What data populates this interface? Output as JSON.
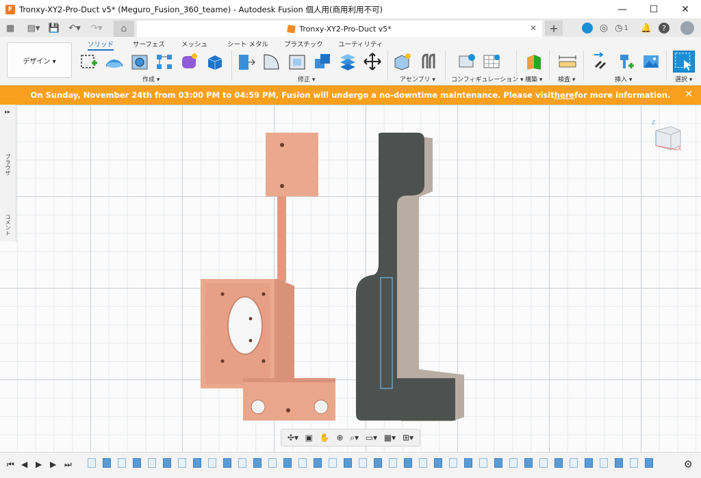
{
  "window": {
    "title": "Tronxy-XY2-Pro-Duct v5* (Meguro_Fusion_360_teame) - Autodesk Fusion 個人用(商用利用不可)",
    "app_icon_letter": "F",
    "minimize": "—",
    "maximize": "☐",
    "close": "✕"
  },
  "tabs": {
    "document_tab": "Tronxy-XY2-Pro-Duct v5*",
    "close_tab": "✕",
    "new_tab": "+",
    "notification_count": "1"
  },
  "ribbon": {
    "workspace": "デザイン ▾",
    "tabs": [
      "ソリッド",
      "サーフェス",
      "メッシュ",
      "シート メタル",
      "プラスチック",
      "ユーティリティ"
    ],
    "groups": {
      "create": "作成 ▾",
      "modify": "修正 ▾",
      "assemble": "アセンブリ ▾",
      "configure": "コンフィギュレーション ▾",
      "construct": "構築 ▾",
      "inspect": "検査 ▾",
      "insert": "挿入 ▾",
      "select": "選択 ▾"
    }
  },
  "banner": {
    "text_before": "On Sunday, November 24th from 03:00 PM to 04:59 PM, Fusion will undergo a no-downtime maintenance. Please visit ",
    "link": "here",
    "text_after": " for more information.",
    "close": "✕"
  },
  "side_panel": {
    "expand": "▸▸",
    "browser": "ブラウザ",
    "comments": "コメント"
  },
  "viewcube": {
    "z_axis": "Z",
    "x_axis": "X"
  },
  "colors": {
    "banner": "#f8a01e",
    "part_copper": "#e9a88c",
    "part_dark": "#4d5250",
    "accent": "#1a73c0"
  },
  "timeline": {
    "first": "⏮",
    "prev": "◀",
    "play": "▶",
    "next": "▶",
    "last": "⏭",
    "settings": "⚙"
  }
}
